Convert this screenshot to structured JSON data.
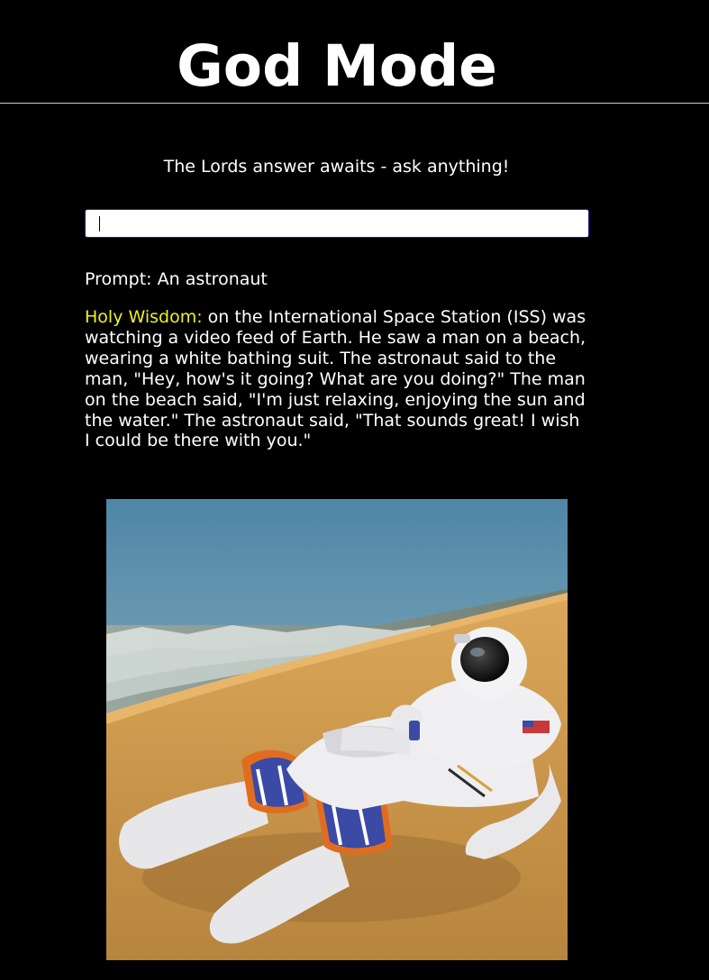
{
  "header": {
    "title": "God Mode"
  },
  "intro": {
    "subtitle": "The Lords answer awaits - ask anything!"
  },
  "search": {
    "value": "",
    "placeholder": ""
  },
  "result": {
    "prompt_label": "Prompt:",
    "prompt_text": "An astronaut",
    "answer_label": "Holy Wisdom:",
    "answer_text": "on the International Space Station (ISS) was watching a video feed of Earth. He saw a man on a beach, wearing a white bathing suit. The astronaut said to the man, \"Hey, how's it going? What are you doing?\" The man on the beach said, \"I'm just relaxing, enjoying the sun and the water.\" The astronaut said, \"That sounds great! I wish I could be there with you.\""
  },
  "image": {
    "icon": "generated-image-astronaut-on-beach"
  },
  "colors": {
    "background": "#000000",
    "text": "#ffffff",
    "answer_label": "#f0f020",
    "input_border": "#1e1ea0"
  }
}
